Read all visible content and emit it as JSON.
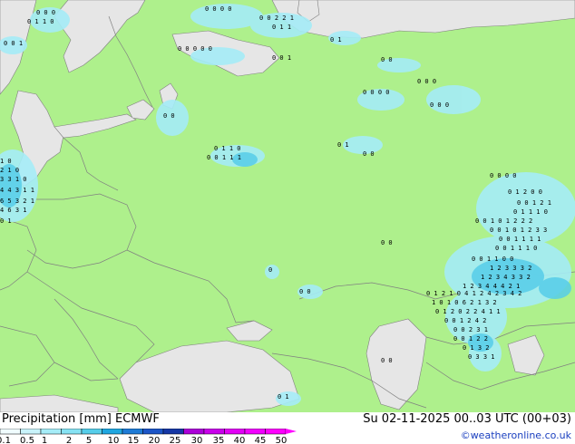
{
  "footer": {
    "title": "Precipitation [mm]  ECMWF",
    "run": "Su 02-11-2025 00..03 UTC (00+03)",
    "credit": "©weatheronline.co.uk"
  },
  "legend": {
    "labels": [
      "0.1",
      "0.5",
      "1",
      "2",
      "5",
      "10",
      "15",
      "20",
      "25",
      "30",
      "35",
      "40",
      "45",
      "50"
    ],
    "colors": [
      "#f0fcff",
      "#c8f3fa",
      "#a5ecf7",
      "#86e2f3",
      "#56cde9",
      "#1fa6e0",
      "#1e7bd6",
      "#1c55c7",
      "#1537a5",
      "#ab00d8",
      "#c800ea",
      "#e100f5",
      "#f100ff",
      "#ff00ff"
    ]
  },
  "map": {
    "land_color": "#aef08c",
    "sea_color": "#e6e6e6",
    "border_color": "#808080",
    "precip_color": "#a5ecf7",
    "precip_strong_color": "#56cde9"
  }
}
